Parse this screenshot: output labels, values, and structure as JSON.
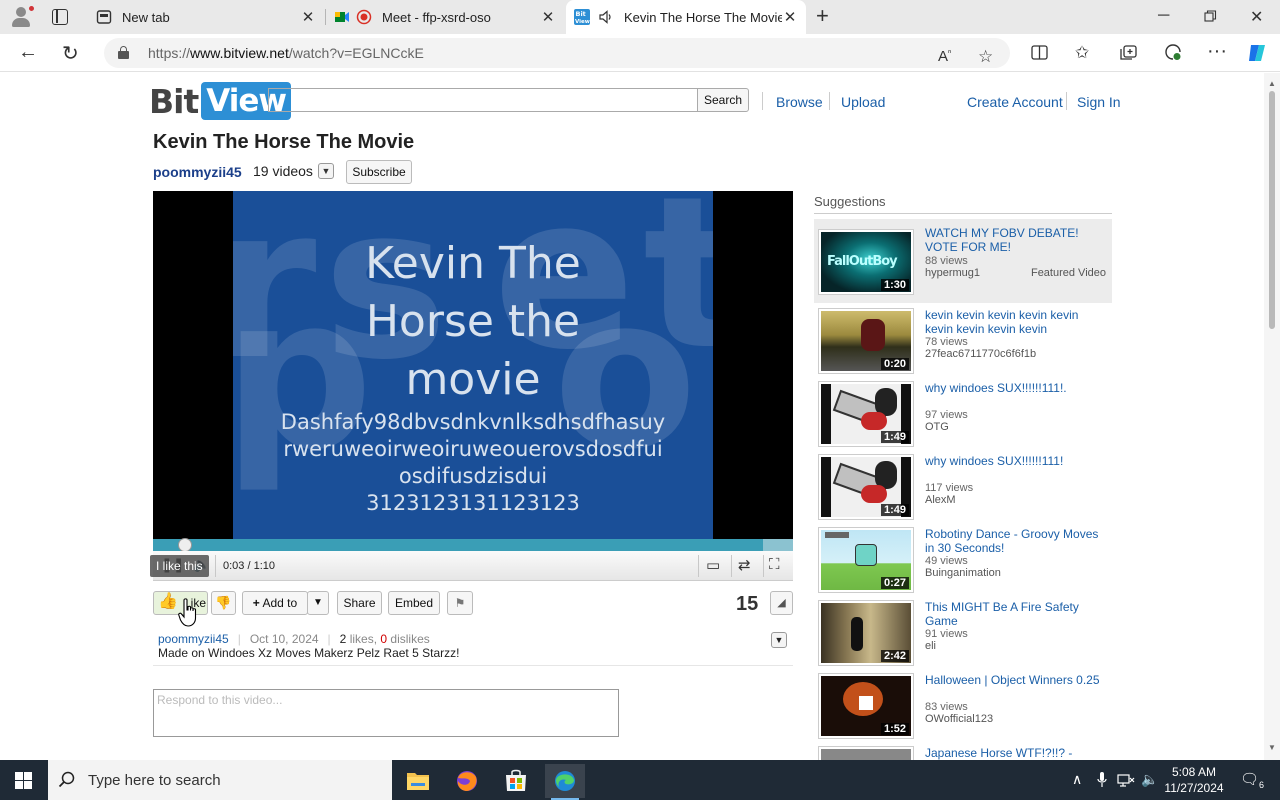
{
  "browser": {
    "tabs": [
      {
        "label": "New tab",
        "icon": "newtab-icon",
        "active": false
      },
      {
        "label": "Meet - ffp-xsrd-oso",
        "icon": "meet-icon",
        "active": false
      },
      {
        "label": "Kevin The Horse The Movie",
        "icon": "bitview-favicon",
        "active": true
      }
    ],
    "url_prefix": "https://",
    "url_host": "www.bitview.net",
    "url_path": "/watch?v=EGLNCckE"
  },
  "site": {
    "logo_bit": "Bit",
    "logo_view": "View",
    "search_button": "Search",
    "nav": {
      "browse": "Browse",
      "upload": "Upload",
      "create_account": "Create Account",
      "sign_in": "Sign In"
    }
  },
  "video": {
    "title": "Kevin The Horse The Movie",
    "uploader": "poommyzii45",
    "uploader_videos": "19 videos",
    "subscribe_label": "Subscribe",
    "frame_title_lines": [
      "Kevin The",
      "Horse the",
      "movie"
    ],
    "frame_text_lines": [
      "Dashfafy98dbvsdnkvnlksdhsdfhasuy",
      "rweruweoirweoiruweouerovsdosdfui",
      "osdifusdzisdui",
      "3123123131123123"
    ],
    "time_current": "0:03",
    "time_total": "1:10",
    "tooltip": "I like this",
    "progress": 0.05,
    "like_label": "Like",
    "add_to_label": "Add to",
    "share_label": "Share",
    "embed_label": "Embed",
    "view_count": "15",
    "upload_date": "Oct 10, 2024",
    "likes": "2",
    "likes_word": "likes,",
    "dislikes": "0",
    "dislikes_word": "dislikes",
    "description": "Made on Windoes Xz Moves Makerz Pelz Raet 5 Starzz!",
    "comment_placeholder": "Respond to this video..."
  },
  "suggestions": {
    "heading": "Suggestions",
    "items": [
      {
        "title": "WATCH MY FOBV DEBATE! VOTE FOR ME!",
        "views": "88 views",
        "author": "hypermug1",
        "duration": "1:30",
        "featured": "Featured Video"
      },
      {
        "title": "kevin kevin kevin kevin kevin kevin kevin kevin kevin",
        "views": "78 views",
        "author": "27feac6711770c6f6f1b",
        "duration": "0:20"
      },
      {
        "title": "why windoes SUX!!!!!!111!.",
        "views": "97 views",
        "author": "OTG",
        "duration": "1:49"
      },
      {
        "title": "why windoes SUX!!!!!!111!",
        "views": "117 views",
        "author": "AlexM",
        "duration": "1:49"
      },
      {
        "title": "Robotiny Dance - Groovy Moves in 30 Seconds!",
        "views": "49 views",
        "author": "Buinganimation",
        "duration": "0:27"
      },
      {
        "title": "This MIGHT Be A Fire Safety Game",
        "views": "91 views",
        "author": "eli",
        "duration": "2:42"
      },
      {
        "title": "Halloween | Object Winners 0.25",
        "views": "83 views",
        "author": "OWofficial123",
        "duration": "1:52"
      },
      {
        "title": "Japanese Horse WTF!?!!? -",
        "views": "",
        "author": "",
        "duration": ""
      }
    ]
  },
  "taskbar": {
    "search_placeholder": "Type here to search",
    "time": "5:08 AM",
    "date": "11/27/2024",
    "notifications": "6"
  }
}
